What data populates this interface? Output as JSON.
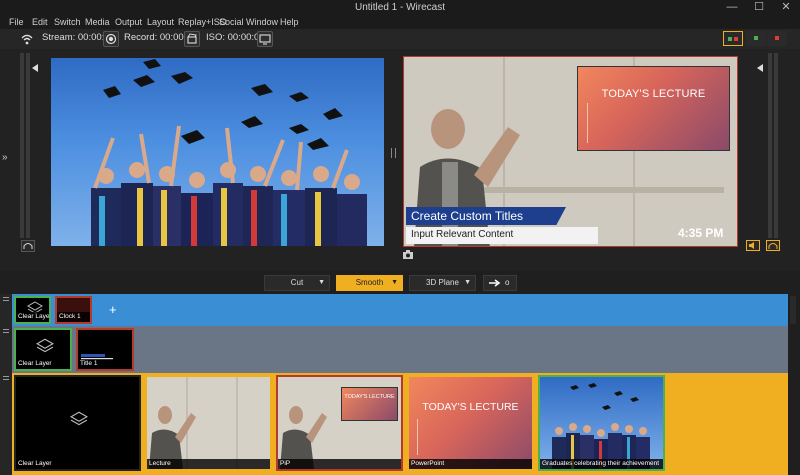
{
  "window": {
    "title": "Untitled 1 - Wirecast"
  },
  "window_controls": {
    "minimize": "—",
    "maximize": "☐",
    "close": "✕"
  },
  "menu": [
    "File",
    "Edit",
    "Switch",
    "Media",
    "Output",
    "Layout",
    "Replay+ISO",
    "Social",
    "Window",
    "Help"
  ],
  "toolbar": {
    "stream_label": "Stream: 00:00:00",
    "record_label": "Record: 00:00:00",
    "iso_label": "ISO: 00:00:00"
  },
  "colors": {
    "accent_orange": "#f0ae21",
    "layer_blue": "#3a8ed3",
    "live_border": "#b43a2e",
    "layer_gray": "#6a7585"
  },
  "live": {
    "title_card": "TODAY'S LECTURE",
    "lower_third_title": "Create Custom Titles",
    "lower_third_sub": "Input Relevant Content",
    "clock": "4:35 PM"
  },
  "transitions": {
    "cut": "Cut",
    "smooth": "Smooth",
    "plane": "3D Plane",
    "go_symbol": "o"
  },
  "layers": {
    "row1": [
      {
        "label": "Clear Layer"
      },
      {
        "label": "Clock 1"
      }
    ],
    "row1_add": "+",
    "row2": [
      {
        "label": "Clear Layer"
      },
      {
        "label": "Title 1"
      }
    ],
    "row3": [
      {
        "label": "Clear Layer"
      },
      {
        "label": "Lecture"
      },
      {
        "label": "PiP",
        "card": "TODAY'S LECTURE"
      },
      {
        "label": "PowerPoint",
        "card": "TODAY'S LECTURE"
      },
      {
        "label": "Graduates celebrating their achievement"
      }
    ]
  }
}
